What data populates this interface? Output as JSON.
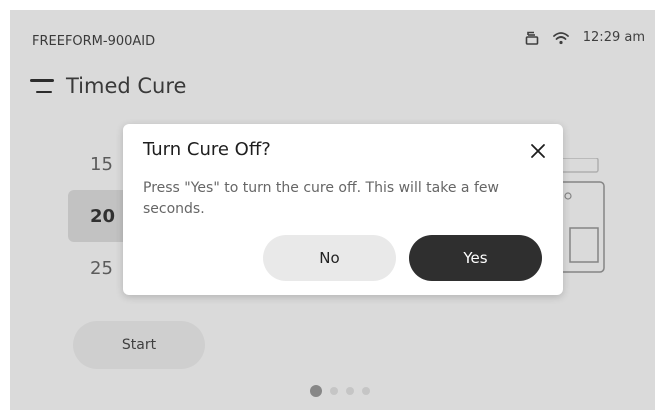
{
  "status_bar": {
    "device_name": "FREEFORM-900AID",
    "time": "12:29 am",
    "icons": [
      "printer-icon",
      "wifi-icon"
    ]
  },
  "header": {
    "title": "Timed Cure",
    "menu_icon": "hamburger-menu-icon"
  },
  "picker": {
    "items": [
      "15",
      "20",
      "25"
    ],
    "selected": "20"
  },
  "start_button": {
    "label": "Start"
  },
  "pagination": {
    "count": 4,
    "active_index": 0
  },
  "dialog": {
    "title": "Turn Cure Off?",
    "message": "Press \"Yes\" to turn the cure off. This will take a few seconds.",
    "no_label": "No",
    "yes_label": "Yes",
    "close_icon": "close-icon"
  },
  "colors": {
    "background": "#f0f0f0",
    "dialog_bg": "#ffffff",
    "primary_button": "#2f2f2f",
    "secondary_button": "#e9e9e9"
  }
}
